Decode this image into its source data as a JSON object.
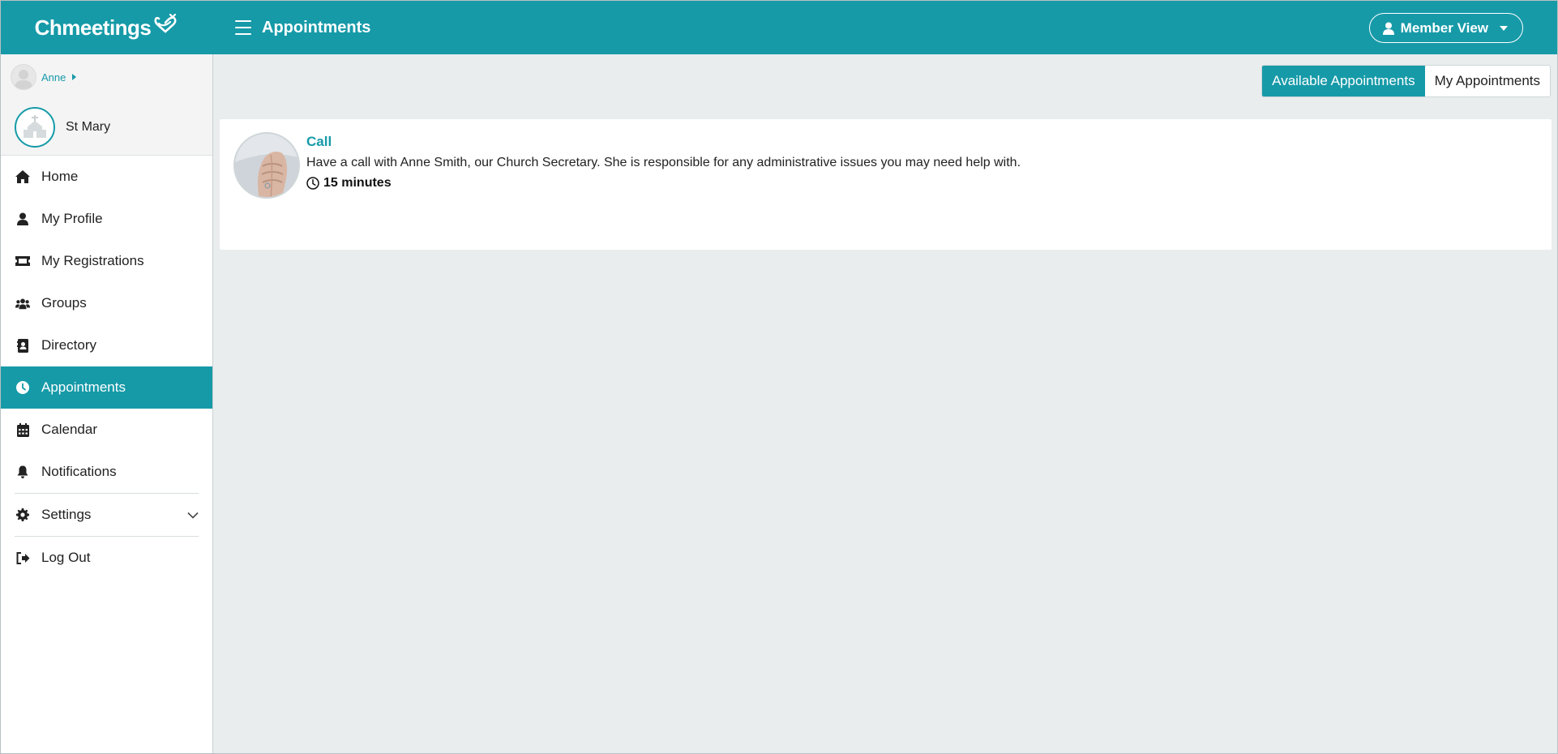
{
  "app": {
    "brand": "Chmeetings",
    "page_title": "Appointments",
    "view_switch_label": "Member View"
  },
  "colors": {
    "primary": "#169aa8",
    "background": "#e9edee"
  },
  "user": {
    "name": "Anne",
    "church": "St Mary"
  },
  "sidebar": {
    "items": [
      {
        "label": "Home",
        "icon": "home-icon"
      },
      {
        "label": "My Profile",
        "icon": "user-icon"
      },
      {
        "label": "My Registrations",
        "icon": "ticket-icon"
      },
      {
        "label": "Groups",
        "icon": "users-icon"
      },
      {
        "label": "Directory",
        "icon": "address-book-icon"
      },
      {
        "label": "Appointments",
        "icon": "clock-icon",
        "active": true
      },
      {
        "label": "Calendar",
        "icon": "calendar-icon"
      },
      {
        "label": "Notifications",
        "icon": "bell-icon"
      },
      {
        "label": "Settings",
        "icon": "gear-icon"
      },
      {
        "label": "Log Out",
        "icon": "sign-out-icon"
      }
    ]
  },
  "tabs": {
    "available": "Available Appointments",
    "mine": "My Appointments",
    "active": "available"
  },
  "appointments": [
    {
      "title": "Call",
      "description": "Have a call with Anne Smith, our Church Secretary. She is responsible for any administrative issues you may need help with.",
      "duration": "15 minutes"
    }
  ]
}
